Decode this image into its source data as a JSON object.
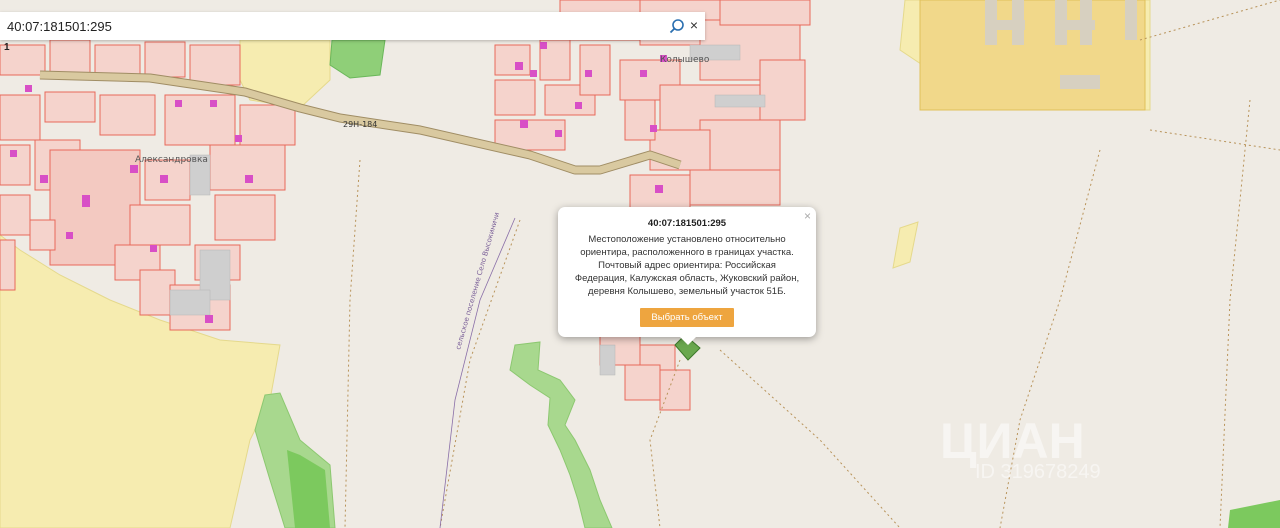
{
  "search": {
    "value": "40:07:181501:295",
    "search_icon": "search-icon",
    "clear_icon": "close-icon",
    "clear_glyph": "×"
  },
  "map": {
    "labels": {
      "road": "29Н-184",
      "village_1": "Александровка",
      "village_2": "Колышево",
      "settlement_boundary": "сельское поселение Село Высокиничи"
    },
    "watermark": "ЦИАН",
    "watermark_id": "ID 319678249",
    "colors": {
      "background": "#efebe4",
      "parcel_fill": "#f5d3cc",
      "parcel_stroke": "#e8685a",
      "building": "#d84fc6",
      "forest": "#7cc95e",
      "field": "#f6ecb0",
      "road": "#c8b88a"
    }
  },
  "popup": {
    "close_glyph": "×",
    "title": "40:07:181501:295",
    "description": "Местоположение установлено относительно ориентира, расположенного в границах участка. Почтовый адрес ориентира: Российская Федерация, Калужская область, Жуковский район, деревня Колышево, земельный участок 51Б.",
    "button_label": "Выбрать объект"
  },
  "toolbar": {
    "tool_glyph": "1"
  }
}
